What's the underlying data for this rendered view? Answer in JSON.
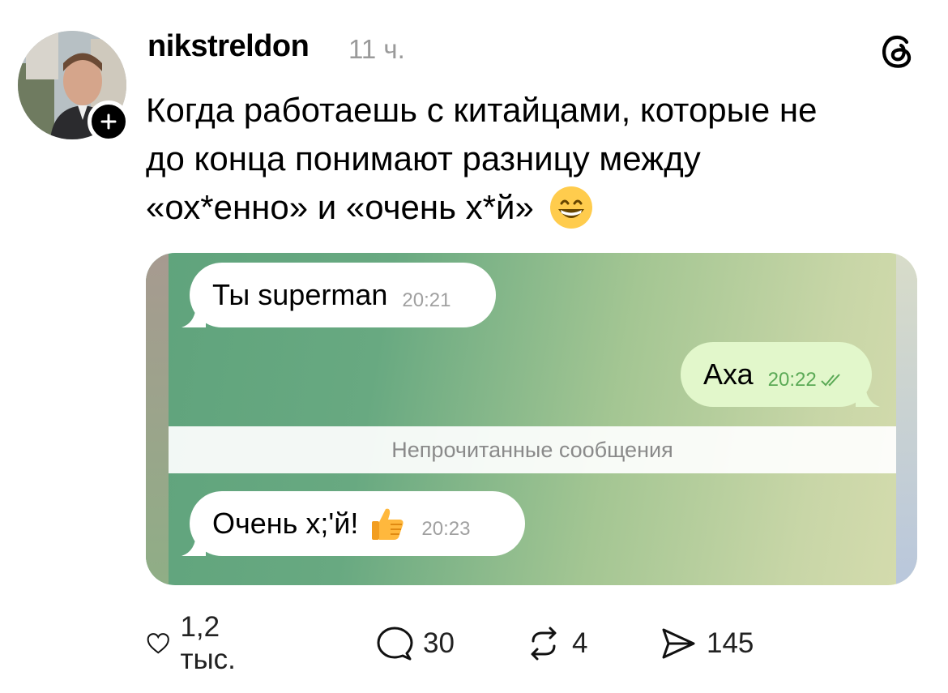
{
  "post": {
    "username": "nikstreldon",
    "time": "11 ч.",
    "text_lines": [
      "Когда работаешь с китайцами, которые не",
      "до конца понимают разницу между",
      "«ох*енно» и «очень х*й»"
    ]
  },
  "chat": {
    "messages": [
      {
        "text": "Ты superman",
        "time": "20:21",
        "direction": "incoming"
      },
      {
        "text": "Аха",
        "time": "20:22",
        "direction": "outgoing"
      },
      {
        "text": "Очень х;'й!",
        "time": "20:23",
        "direction": "incoming"
      }
    ],
    "unread_label": "Непрочитанные сообщения"
  },
  "actions": {
    "likes": "1,2 тыс.",
    "comments": "30",
    "reposts": "4",
    "shares": "145"
  },
  "icons": {
    "avatar": "user-avatar",
    "follow": "plus-icon",
    "threads": "threads-logo-icon",
    "emoji": "grinning-face-icon",
    "like": "heart-icon",
    "comment": "speech-bubble-icon",
    "repost": "repost-icon",
    "share": "send-icon",
    "thumbs": "thumbs-up-icon",
    "read_checks": "double-check-icon"
  },
  "colors": {
    "outgoing_bubble": "#e2f7cb",
    "incoming_bubble": "#ffffff",
    "time_read": "#5aa955"
  }
}
